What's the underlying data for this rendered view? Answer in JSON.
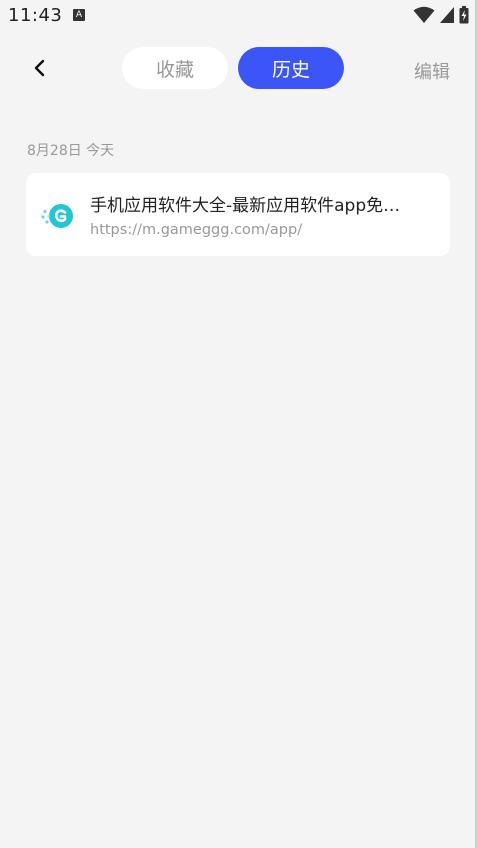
{
  "status_bar": {
    "time": "11:43",
    "notification_icon_letter": "A"
  },
  "nav": {
    "tabs": [
      {
        "label": "收藏",
        "active": false
      },
      {
        "label": "历史",
        "active": true
      }
    ],
    "edit_label": "编辑"
  },
  "history": {
    "date_header": "8月28日 今天",
    "items": [
      {
        "title": "手机应用软件大全-最新应用软件app免…",
        "url": "https://m.gameggg.com/app/",
        "icon": "gameggg-site-icon"
      }
    ]
  },
  "colors": {
    "accent": "#3b55f7",
    "background": "#f4f4f4",
    "muted_text": "#999999"
  }
}
